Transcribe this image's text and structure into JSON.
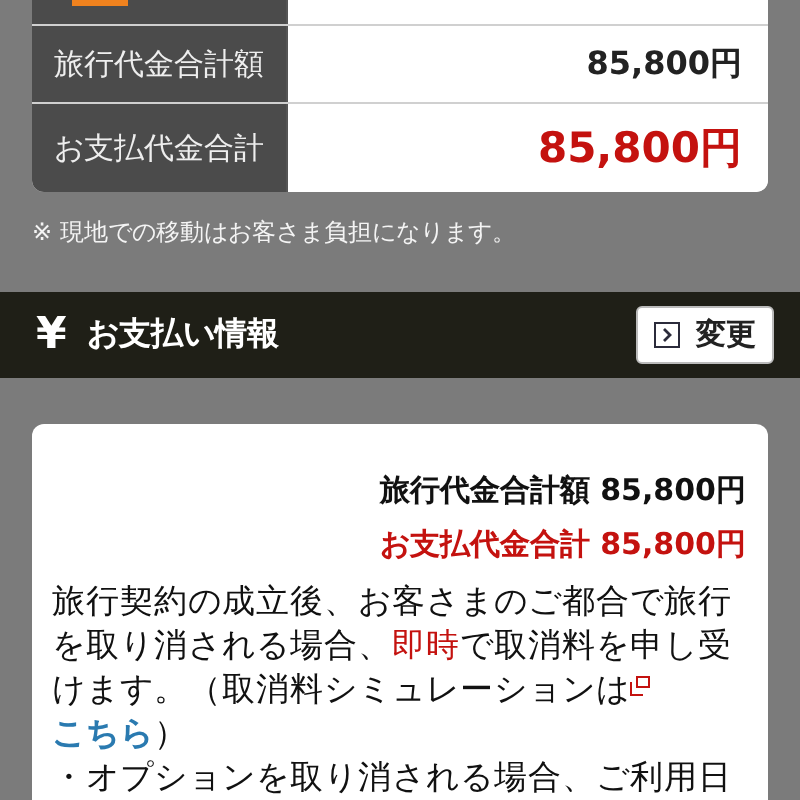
{
  "summary_table": {
    "rows": [
      {
        "kind": "partial"
      },
      {
        "kind": "normal",
        "label": "旅行代金合計額",
        "value": "85,800円"
      },
      {
        "kind": "highlight",
        "label": "お支払代金合計",
        "value": "85,800円"
      }
    ]
  },
  "note": "※ 現地での移動はお客さま負担になります。",
  "section_header": {
    "title": "お支払い情報",
    "icon": "¥",
    "button": "変更"
  },
  "payment_card": {
    "totals": [
      {
        "kind": "normal",
        "text": "旅行代金合計額 85,800円"
      },
      {
        "kind": "highlight",
        "text": "お支払代金合計 85,800円"
      }
    ],
    "paragraphs": [
      [
        {
          "kind": "text",
          "text": "旅行契約の成立後、お客さまのご都合で旅行を取り消される場合、"
        },
        {
          "kind": "emphasis",
          "text": "即時"
        },
        {
          "kind": "text",
          "text": "で取消料を申し受けます。（取消料シミュレーションは"
        },
        {
          "kind": "link",
          "text": "こちら"
        },
        {
          "kind": "text",
          "text": "）"
        }
      ],
      [
        {
          "kind": "text",
          "text": "・オプションを取り消される場合、ご利用日"
        }
      ]
    ]
  }
}
